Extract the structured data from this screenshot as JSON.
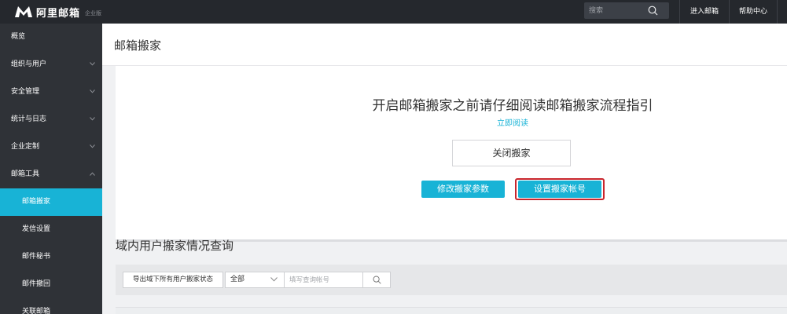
{
  "header": {
    "logo_text": "阿里邮箱",
    "logo_sub": "企业版",
    "logo_icon": "m-logo-icon",
    "search_placeholder": "搜索",
    "search_icon": "search-icon",
    "links": [
      "进入邮箱",
      "帮助中心"
    ]
  },
  "sidebar": {
    "items": [
      {
        "label": "概览"
      },
      {
        "label": "组织与用户"
      },
      {
        "label": "安全管理"
      },
      {
        "label": "统计与日志"
      },
      {
        "label": "企业定制"
      },
      {
        "label": "邮箱工具"
      },
      {
        "label": "邮箱搬家"
      },
      {
        "label": "发信设置"
      },
      {
        "label": "邮件秘书"
      },
      {
        "label": "邮件撤回"
      },
      {
        "label": "关联邮箱"
      }
    ],
    "active_color": "#18b3d6"
  },
  "main": {
    "page_title": "邮箱搬家",
    "headline": "开启邮箱搬家之前请仔细阅读邮箱搬家流程指引",
    "read_link": "立即阅读",
    "close_button": "关闭搬家",
    "modify_button": "修改搬家参数",
    "setup_button": "设置搬家帐号",
    "section_title": "域内用户搬家情况查询",
    "export_button": "导出域下所有用户搬家状态",
    "filter_select": "全部",
    "query_placeholder": "填写查询帐号"
  },
  "colors": {
    "accent": "#18b3d6",
    "highlight": "#c9262d",
    "topbar": "#25282d",
    "sidebar": "#2f3237"
  }
}
